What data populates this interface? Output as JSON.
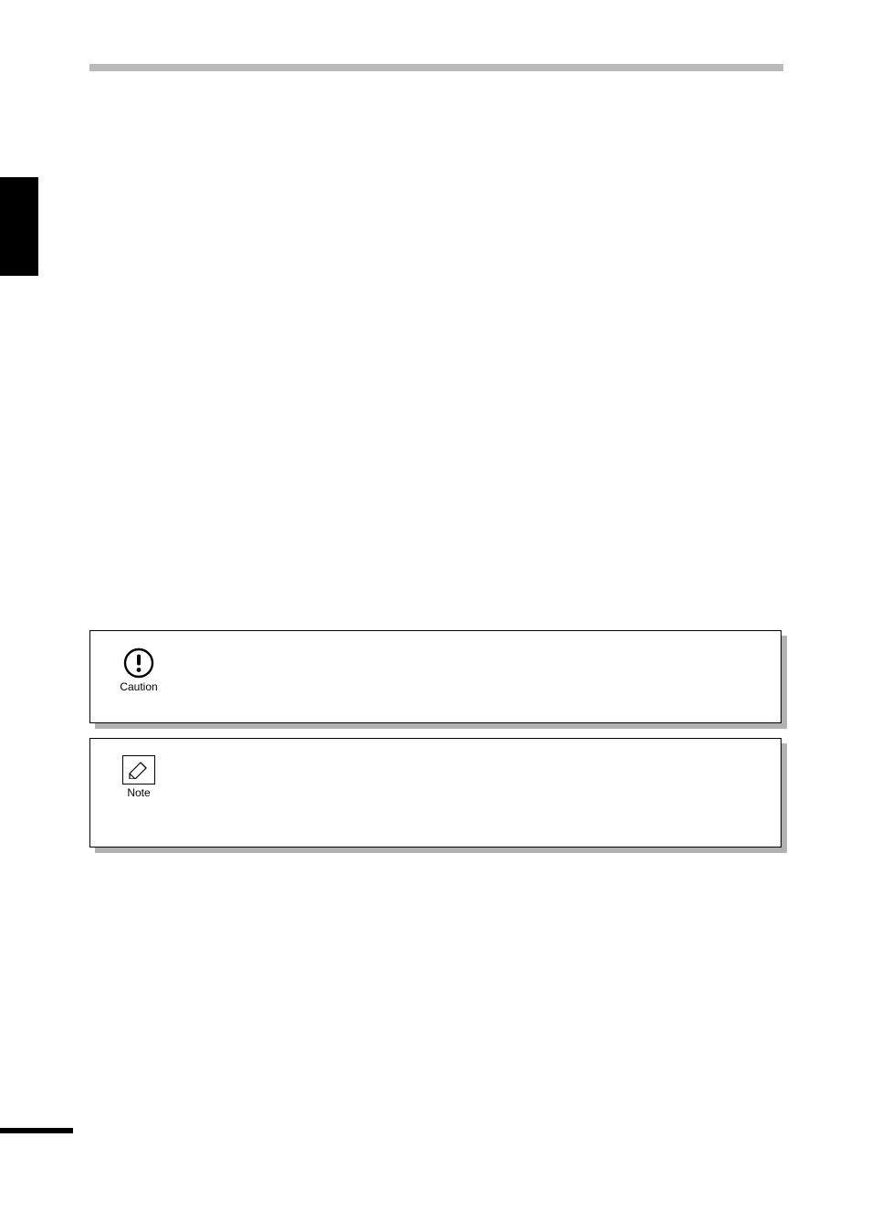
{
  "callouts": {
    "caution": {
      "label": "Caution"
    },
    "note": {
      "label": "Note"
    }
  }
}
